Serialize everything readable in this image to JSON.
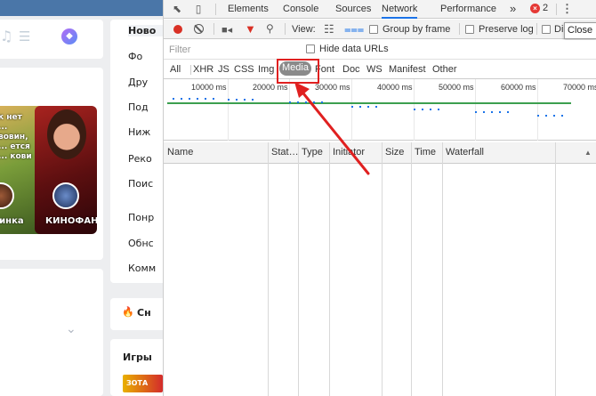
{
  "site": {
    "menu_items": [
      "Ново",
      "Фо",
      "Дру",
      "Под",
      "Ниж",
      "Реко",
      "Поис",
      "Понр",
      "Обнс",
      "Комм"
    ],
    "stories": {
      "story1_text": "к нет ... вовин, ... ется ... кови",
      "story1_name": "ринка",
      "story2_name": "КИНОФАН"
    },
    "popular_label": "Сн",
    "games_label": "Игры",
    "game_thumb_text": "ЗОТА"
  },
  "devtools": {
    "tabs": [
      "Elements",
      "Console",
      "Sources",
      "Network",
      "Performance"
    ],
    "active_tab": "Network",
    "more_tabs": "»",
    "error_count": "2",
    "toolbar": {
      "view_label": "View:",
      "group_by_frame": "Group by frame",
      "preserve_log": "Preserve log",
      "disable_cache": "Di"
    },
    "close_tooltip": "Close",
    "filter": {
      "placeholder": "Filter",
      "hide_data_urls": "Hide data URLs"
    },
    "types": [
      "All",
      "XHR",
      "JS",
      "CSS",
      "Img",
      "Media",
      "Font",
      "Doc",
      "WS",
      "Manifest",
      "Other"
    ],
    "active_type": "Media",
    "overview": {
      "labels": [
        "10000 ms",
        "20000 ms",
        "30000 ms",
        "40000 ms",
        "50000 ms",
        "60000 ms",
        "70000 ms"
      ]
    },
    "columns": [
      "Name",
      "Status",
      "Type",
      "Initiator",
      "Size",
      "Time",
      "Waterfall"
    ],
    "status_col_display": "Stat…"
  },
  "colors": {
    "record": "#d93025",
    "active_tab_underline": "#1a73e8",
    "annotation": "#e02020",
    "timeline_green": "#3c9f4f"
  }
}
